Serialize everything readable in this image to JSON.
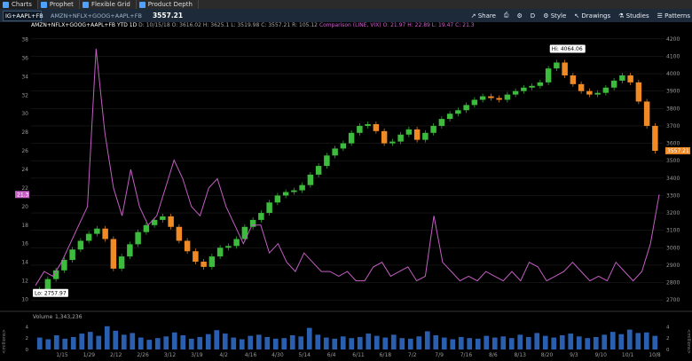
{
  "tabs": [
    {
      "label": "Charts",
      "color": "#4da3ff"
    },
    {
      "label": "Prophet",
      "color": "#4da3ff"
    },
    {
      "label": "Flexible Grid",
      "color": "#4da3ff"
    },
    {
      "label": "Product Depth",
      "color": "#4da3ff"
    }
  ],
  "toolbar": {
    "symbol": "IG+AAPL+FB",
    "compare_symbol": "AMZN+NFLX+GOOG+AAPL+FB",
    "last_price": "3557.21",
    "share": "Share",
    "period": "D",
    "style": "Style",
    "drawings": "Drawings",
    "studies": "Studies",
    "patterns": "Patterns"
  },
  "info": {
    "title": "AMZN+NFLX+GOOG+AAPL+FB YTD 1D",
    "date": "D: 10/15/18",
    "open": "O: 3616.02",
    "high": "H: 3625.1",
    "low": "L: 3519.98",
    "close": "C: 3557.21",
    "range": "R: 105.12",
    "comparison": "Comparison (LINE, VIX)",
    "cmp_open": "O: 21.97",
    "cmp_high": "H: 22.89",
    "cmp_low": "L: 19.47",
    "cmp_close": "C: 21.3"
  },
  "labels": {
    "high_bubble": "Hi: 4064.06",
    "low_bubble": "Lo: 2757.97",
    "price_tag": "3557.21",
    "vix_tag": "21.3",
    "volume_label": "Volume",
    "volume_value": "1,343,236",
    "millions_left": "<millions>",
    "millions_right": "<millions>"
  },
  "colors": {
    "up": "#3dbb3d",
    "down": "#f08a24",
    "vix": "#c45ec4",
    "grid": "#1e1e1e",
    "axis_text": "#9a9a9a",
    "volume": "#2a5fb0"
  },
  "chart_data": [
    {
      "type": "candlestick",
      "title": "AMZN+NFLX+GOOG+AAPL+FB YTD 1D",
      "x_labels": [
        "1/15",
        "1/29",
        "2/12",
        "2/26",
        "3/12",
        "3/19",
        "4/2",
        "4/16",
        "4/30",
        "5/14",
        "6/4",
        "6/11",
        "6/18",
        "7/2",
        "7/9",
        "7/16",
        "8/6",
        "8/13",
        "8/20",
        "9/3",
        "9/10",
        "10/1",
        "10/8"
      ],
      "y_right_ticks": [
        2700,
        2800,
        2900,
        3000,
        3100,
        3200,
        3300,
        3400,
        3500,
        3600,
        3700,
        3800,
        3900,
        4000,
        4100,
        4200
      ],
      "y_left_ticks": [
        10,
        12,
        14,
        16,
        18,
        20,
        22,
        24,
        26,
        28,
        30,
        32,
        34,
        36,
        38
      ],
      "ylim_right": [
        2650,
        4250
      ],
      "ylim_left": [
        9,
        39
      ],
      "series": [
        {
          "name": "AMZN+NFLX+GOOG+AAPL+FB",
          "closes": [
            2760,
            2820,
            2870,
            2930,
            2990,
            3040,
            3080,
            3110,
            3050,
            2880,
            2950,
            3020,
            3090,
            3130,
            3160,
            3180,
            3120,
            3040,
            2980,
            2920,
            2890,
            2950,
            3000,
            3010,
            3050,
            3120,
            3160,
            3200,
            3260,
            3300,
            3320,
            3330,
            3360,
            3420,
            3470,
            3530,
            3570,
            3600,
            3660,
            3700,
            3710,
            3670,
            3600,
            3610,
            3650,
            3680,
            3620,
            3660,
            3700,
            3740,
            3770,
            3790,
            3820,
            3850,
            3870,
            3860,
            3850,
            3880,
            3900,
            3920,
            3930,
            3950,
            4030,
            4064,
            3990,
            3940,
            3900,
            3880,
            3890,
            3920,
            3960,
            3990,
            3950,
            3840,
            3700,
            3557
          ],
          "highlight_high": 4064.06,
          "highlight_low": 2757.97,
          "last": 3557.21
        },
        {
          "name": "VIX",
          "values": [
            11.5,
            13,
            12.5,
            14,
            16,
            18,
            20,
            37,
            28,
            22,
            19,
            24,
            20,
            18,
            19,
            22,
            25,
            23,
            20,
            19,
            22,
            23,
            20,
            18,
            16,
            18,
            18,
            15,
            16,
            14,
            13,
            15,
            14,
            13,
            13,
            12.5,
            13,
            12,
            12,
            13.5,
            14,
            12.5,
            13,
            13.5,
            12,
            12.5,
            19,
            14,
            13,
            12,
            12.5,
            12,
            13,
            12.5,
            12,
            13,
            12,
            14,
            13.5,
            12,
            12.5,
            13,
            14,
            13,
            12,
            12.5,
            12,
            14,
            13,
            12,
            13,
            16,
            21.3
          ]
        }
      ]
    },
    {
      "type": "bar",
      "title": "Volume",
      "y_ticks": [
        0,
        2,
        4
      ],
      "values": [
        2.1,
        1.8,
        2.5,
        1.9,
        2.2,
        2.8,
        3.1,
        2.4,
        4.1,
        3.3,
        2.6,
        2.9,
        2.1,
        1.7,
        2.0,
        2.3,
        3.0,
        2.5,
        1.9,
        2.2,
        2.7,
        3.4,
        2.8,
        2.1,
        1.8,
        2.4,
        2.6,
        2.2,
        1.9,
        2.0,
        2.5,
        2.3,
        3.8,
        2.6,
        2.1,
        1.9,
        2.3,
        2.0,
        2.2,
        2.8,
        2.4,
        2.1,
        2.6,
        2.0,
        1.9,
        2.3,
        3.2,
        2.5,
        2.1,
        1.8,
        2.2,
        2.0,
        1.9,
        2.4,
        2.1,
        2.3,
        2.0,
        2.6,
        2.2,
        2.9,
        2.4,
        2.1,
        2.5,
        2.8,
        2.3,
        2.0,
        2.2,
        2.6,
        3.1,
        2.7,
        3.5,
        2.9,
        3.0,
        2.4
      ]
    }
  ]
}
